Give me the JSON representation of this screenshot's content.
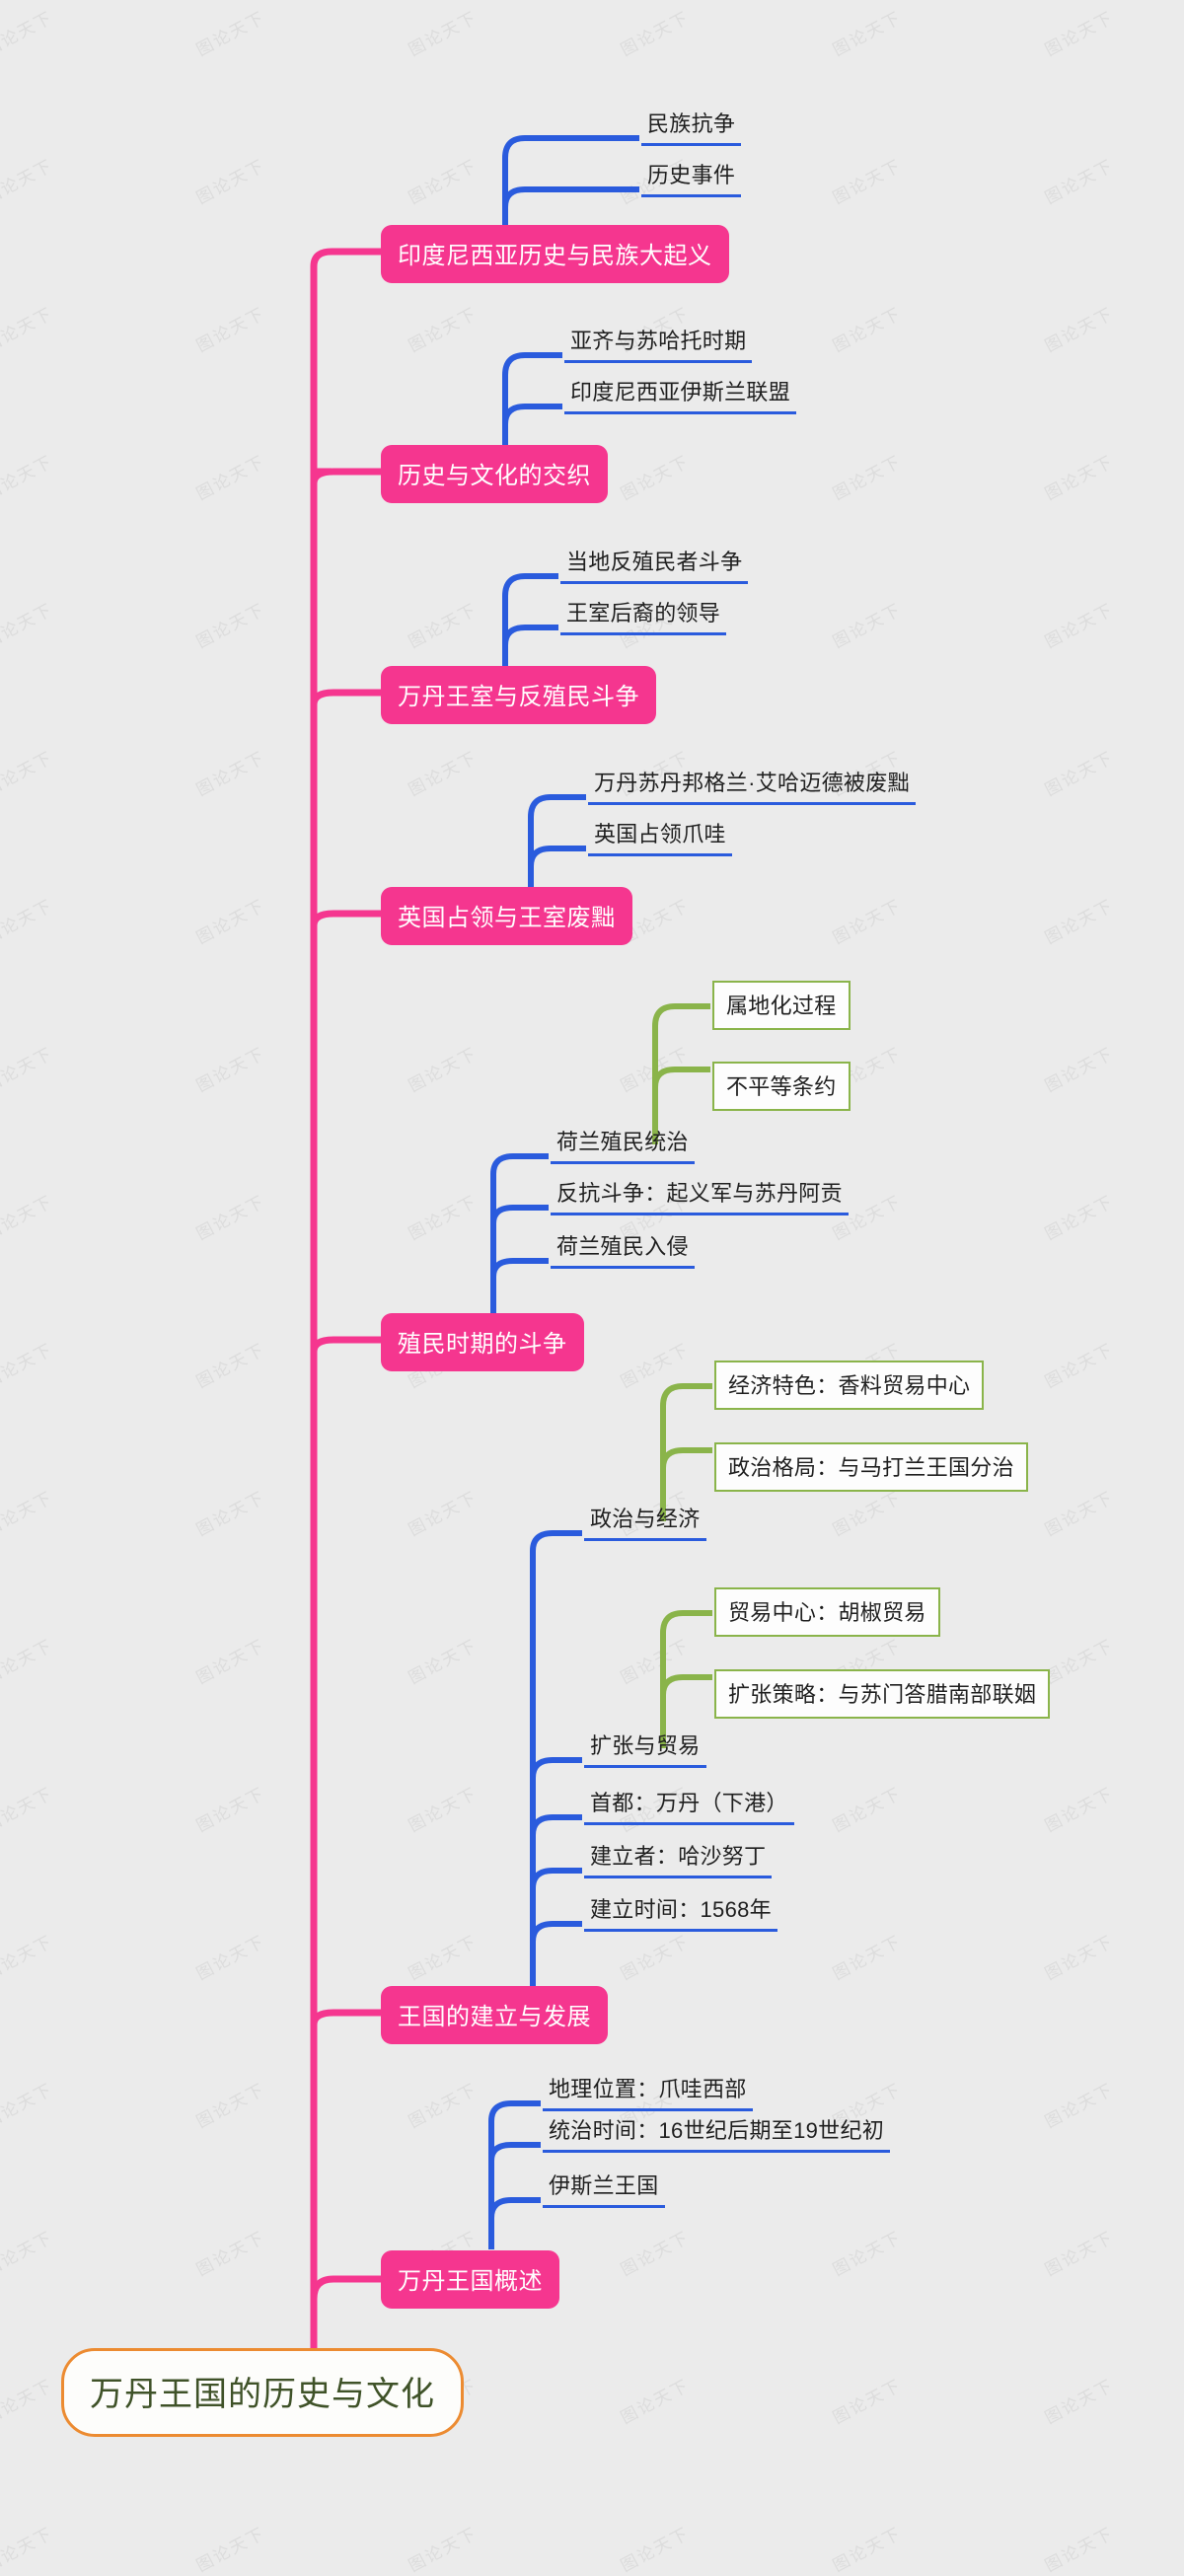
{
  "document": {
    "type": "mindmap",
    "title": "万丹王国的历史与文化",
    "watermark": "图论天下",
    "colors": {
      "background": "#ebebeb",
      "root_border": "#ec8b31",
      "root_text": "#3f5228",
      "level1_fill": "#f5368f",
      "level1_text": "#ffffff",
      "level2_underline": "#2a5bdd",
      "level2_box_border": "#8ab44a",
      "text": "#1f1f1f"
    }
  },
  "root": {
    "label": "万丹王国的历史与文化"
  },
  "branches": [
    {
      "label": "印度尼西亚历史与民族大起义",
      "children": [
        {
          "label": "民族抗争",
          "style": "underline"
        },
        {
          "label": "历史事件",
          "style": "underline"
        }
      ]
    },
    {
      "label": "历史与文化的交织",
      "children": [
        {
          "label": "亚齐与苏哈托时期",
          "style": "underline"
        },
        {
          "label": "印度尼西亚伊斯兰联盟",
          "style": "underline"
        }
      ]
    },
    {
      "label": "万丹王室与反殖民斗争",
      "children": [
        {
          "label": "当地反殖民者斗争",
          "style": "underline"
        },
        {
          "label": "王室后裔的领导",
          "style": "underline"
        }
      ]
    },
    {
      "label": "英国占领与王室废黜",
      "children": [
        {
          "label": "万丹苏丹邦格兰·艾哈迈德被废黜",
          "style": "underline"
        },
        {
          "label": "英国占领爪哇",
          "style": "underline"
        }
      ]
    },
    {
      "label": "殖民时期的斗争",
      "children": [
        {
          "label": "荷兰殖民统治",
          "style": "underline",
          "children": [
            {
              "label": "属地化过程",
              "style": "box"
            },
            {
              "label": "不平等条约",
              "style": "box"
            }
          ]
        },
        {
          "label": "反抗斗争：起义军与苏丹阿贡",
          "style": "underline"
        },
        {
          "label": "荷兰殖民入侵",
          "style": "underline"
        }
      ]
    },
    {
      "label": "王国的建立与发展",
      "children": [
        {
          "label": "政治与经济",
          "style": "underline",
          "children": [
            {
              "label": "经济特色：香料贸易中心",
              "style": "box"
            },
            {
              "label": "政治格局：与马打兰王国分治",
              "style": "box"
            }
          ]
        },
        {
          "label": "扩张与贸易",
          "style": "underline",
          "children": [
            {
              "label": "贸易中心：胡椒贸易",
              "style": "box"
            },
            {
              "label": "扩张策略：与苏门答腊南部联姻",
              "style": "box"
            }
          ]
        },
        {
          "label": "首都：万丹（下港）",
          "style": "underline"
        },
        {
          "label": "建立者：哈沙努丁",
          "style": "underline"
        },
        {
          "label": "建立时间：1568年",
          "style": "underline"
        }
      ]
    },
    {
      "label": "万丹王国概述",
      "children": [
        {
          "label": "地理位置：爪哇西部",
          "style": "underline"
        },
        {
          "label": "统治时间：16世纪后期至19世纪初",
          "style": "underline"
        },
        {
          "label": "伊斯兰王国",
          "style": "underline"
        }
      ]
    }
  ]
}
